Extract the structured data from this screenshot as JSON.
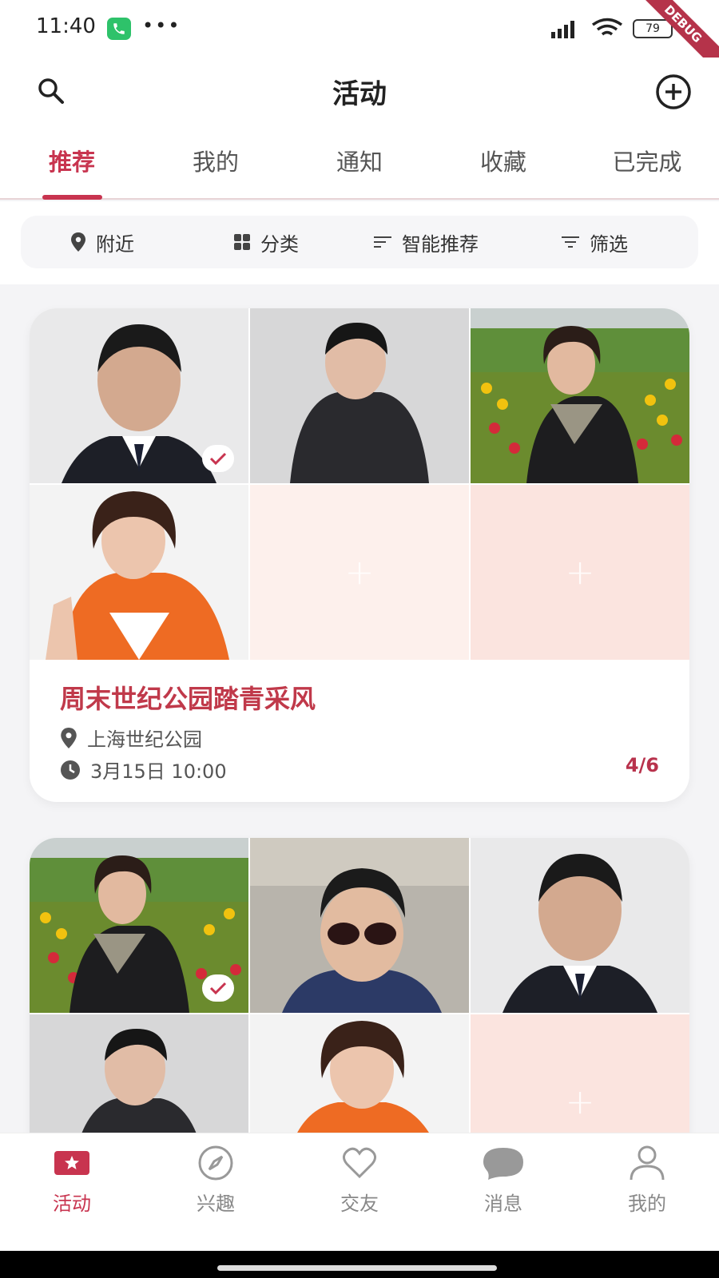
{
  "status_bar": {
    "time": "11:40",
    "battery": "79",
    "debug_ribbon": "DEBUG"
  },
  "header": {
    "title": "活动"
  },
  "tabs": [
    {
      "label": "推荐",
      "active": true
    },
    {
      "label": "我的"
    },
    {
      "label": "通知"
    },
    {
      "label": "收藏"
    },
    {
      "label": "已完成"
    }
  ],
  "filters": [
    {
      "label": "附近",
      "icon": "location-pin-icon"
    },
    {
      "label": "分类",
      "icon": "grid-icon"
    },
    {
      "label": "智能推荐",
      "icon": "sort-icon"
    },
    {
      "label": "筛选",
      "icon": "filter-icon"
    }
  ],
  "events": [
    {
      "title": "周末世纪公园踏青采风",
      "location": "上海世纪公园",
      "time": "3月15日 10:00",
      "count": "4/6"
    },
    {
      "title": "",
      "location": "",
      "time": "",
      "count": ""
    }
  ],
  "nav": [
    {
      "label": "活动",
      "active": true
    },
    {
      "label": "兴趣"
    },
    {
      "label": "交友"
    },
    {
      "label": "消息"
    },
    {
      "label": "我的"
    }
  ],
  "colors": {
    "accent": "#c8344f",
    "placeholder": "#fbe4df",
    "background": "#f4f4f6"
  }
}
